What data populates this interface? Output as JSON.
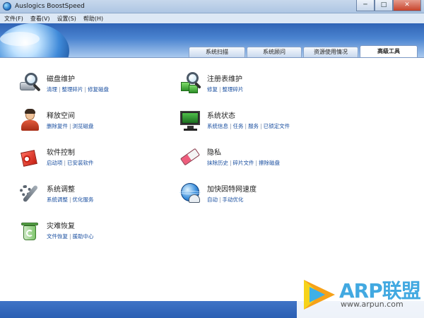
{
  "window": {
    "title": "Auslogics BoostSpeed",
    "minimize": "─",
    "maximize": "□",
    "close": "✕"
  },
  "menu": [
    "文件(F)",
    "查看(V)",
    "设置(S)",
    "帮助(H)"
  ],
  "tabs": [
    {
      "label": "系统扫描",
      "active": false
    },
    {
      "label": "系统顾问",
      "active": false
    },
    {
      "label": "资源使用情况",
      "active": false
    },
    {
      "label": "高级工具",
      "active": true
    }
  ],
  "tools": {
    "disk": {
      "title": "磁盘维护",
      "icon": "disk-magnifier-icon",
      "links": [
        "清理",
        "整理碎片",
        "修复磁盘"
      ]
    },
    "registry": {
      "title": "注册表维护",
      "icon": "registry-magnifier-icon",
      "links": [
        "修复",
        "整理碎片"
      ]
    },
    "space": {
      "title": "释放空间",
      "icon": "user-icon",
      "links": [
        "删除复件",
        "浏览磁盘"
      ]
    },
    "status": {
      "title": "系统状态",
      "icon": "monitor-icon",
      "links": [
        "系统信息",
        "任务",
        "服务",
        "已锁定文件"
      ]
    },
    "software": {
      "title": "软件控制",
      "icon": "software-box-icon",
      "links": [
        "启动项",
        "已安装软件"
      ]
    },
    "privacy": {
      "title": "隐私",
      "icon": "eraser-icon",
      "links": [
        "抹除历史",
        "碎片文件",
        "擦除磁盘"
      ]
    },
    "tweak": {
      "title": "系统调整",
      "icon": "tools-icon",
      "links": [
        "系统调整",
        "优化服务"
      ]
    },
    "internet": {
      "title": "加快因特网速度",
      "icon": "globe-speed-icon",
      "links": [
        "自动",
        "手动优化"
      ]
    },
    "rescue": {
      "title": "灾难恢复",
      "icon": "recycle-bin-icon",
      "links": [
        "文件恢复",
        "援助中心"
      ]
    }
  },
  "watermark": {
    "name": "ARP联盟",
    "url": "www.arpun.com"
  },
  "colors": {
    "link": "#1a4fa0",
    "header": "#2f63b5",
    "watermark": "#42a9e1"
  }
}
